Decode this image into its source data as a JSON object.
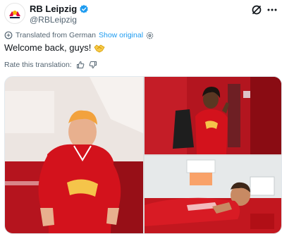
{
  "account": {
    "name": "RB Leipzig",
    "handle": "@RBLeipzig",
    "verified": true,
    "avatar_icon": "rb-leipzig-logo"
  },
  "translation": {
    "label": "Translated from German",
    "show_original": "Show original",
    "settings_icon": "gear-icon",
    "rate_label": "Rate this translation:"
  },
  "tweet": {
    "text": "Welcome back, guys!"
  },
  "media": {
    "photos": [
      "photo-player-blonde",
      "photo-player-dark-room",
      "photo-player-lying"
    ]
  },
  "colors": {
    "brand_red": "#dd0741",
    "link_blue": "#1d9bf0",
    "verified_blue": "#1d9bf0"
  }
}
